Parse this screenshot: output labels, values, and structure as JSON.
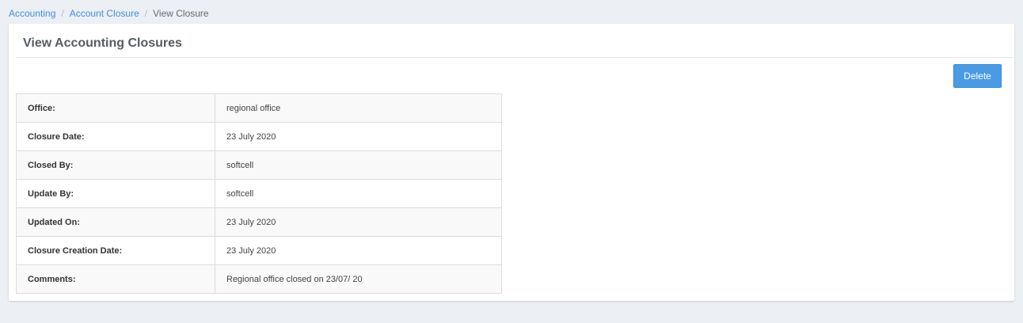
{
  "breadcrumb": {
    "items": [
      "Accounting",
      "Account Closure"
    ],
    "current": "View Closure",
    "separator": "/"
  },
  "page": {
    "title": "View Accounting Closures",
    "delete_label": "Delete"
  },
  "details": [
    {
      "label": "Office:",
      "value": "regional office"
    },
    {
      "label": "Closure Date:",
      "value": "23 July 2020"
    },
    {
      "label": "Closed By:",
      "value": "softcell"
    },
    {
      "label": "Update By:",
      "value": "softcell"
    },
    {
      "label": "Updated On:",
      "value": "23 July 2020"
    },
    {
      "label": "Closure Creation Date:",
      "value": "23 July 2020"
    },
    {
      "label": "Comments:",
      "value": "Regional office closed on 23/07/ 20"
    }
  ],
  "colors": {
    "link": "#3f8fe0",
    "primary_button": "#4a9be6",
    "background": "#eceff3"
  }
}
